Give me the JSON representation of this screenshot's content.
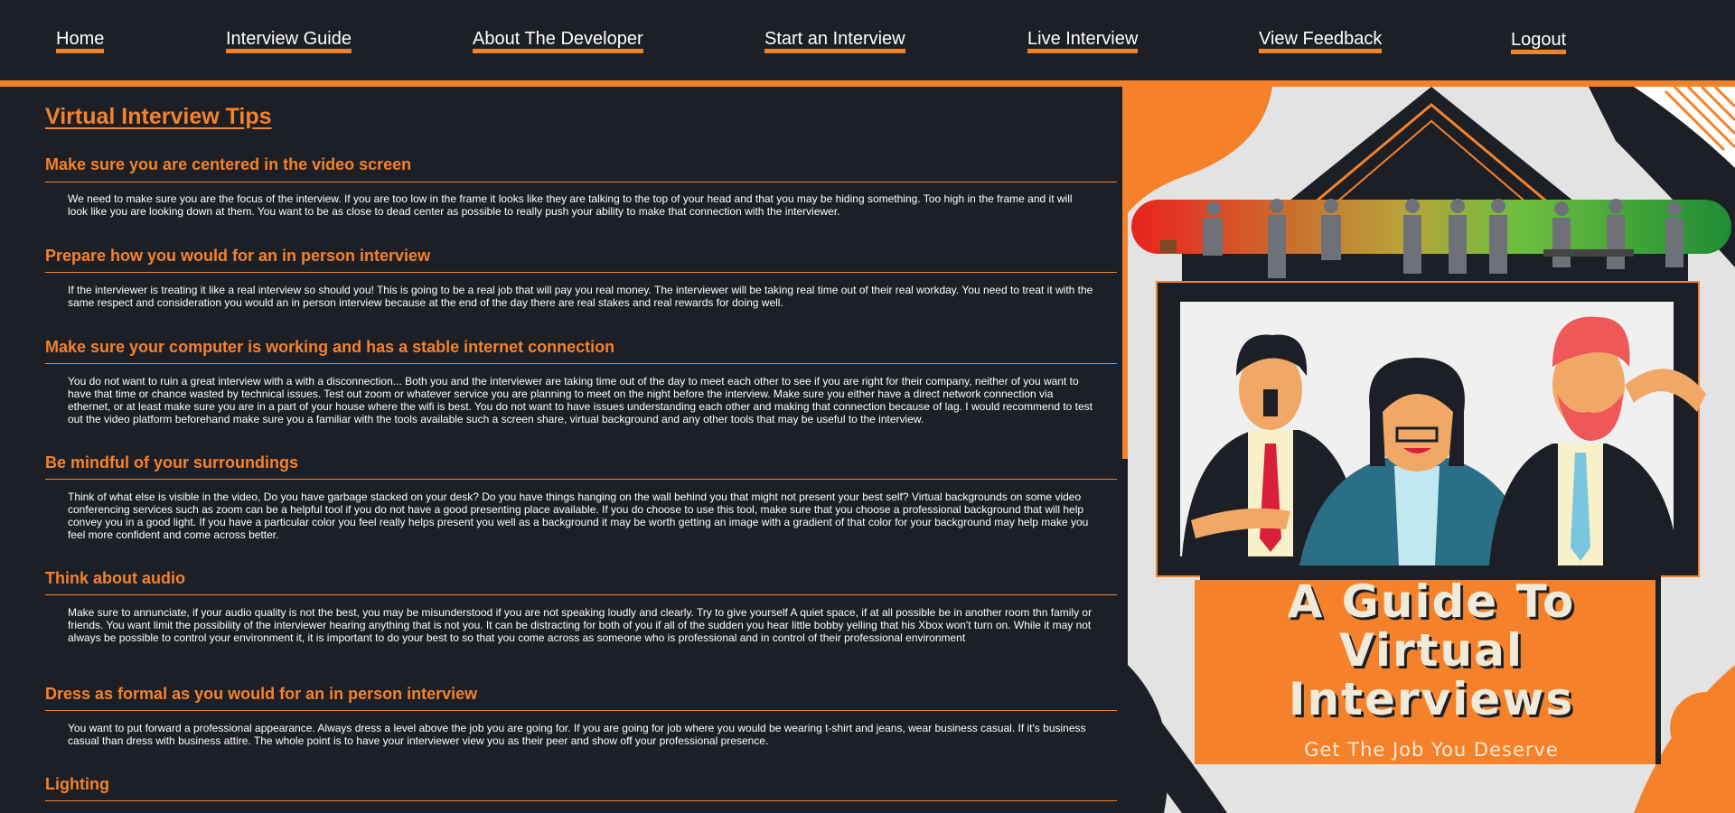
{
  "nav": {
    "items": [
      {
        "label": "Home"
      },
      {
        "label": "Interview Guide"
      },
      {
        "label": "About The Developer"
      },
      {
        "label": "Start an Interview"
      },
      {
        "label": "Live Interview"
      },
      {
        "label": "View Feedback"
      },
      {
        "label": "Logout"
      }
    ]
  },
  "main": {
    "title": "Virtual Interview Tips",
    "sections": [
      {
        "heading": "Make sure you are centered in the video screen",
        "body": "We need to make sure you are the focus of the interview. If you are too low in the frame it looks like they are talking to the top of your head and that you may be hiding something. Too high in the frame and it will look like you are looking down at them. You want to be as close to dead center as possible to really push your ability to make that connection with the interviewer."
      },
      {
        "heading": "Prepare how you would for an in person interview",
        "body": "If the interviewer is treating it like a real interview so should you! This is going to be a real job that will pay you real money. The interviewer will be taking real time out of their real workday. You need to treat it with the same respect and consideration you would an in person interview because at the end of the day there are real stakes and real rewards for doing well."
      },
      {
        "heading": "Make sure your computer is working and has a stable internet connection",
        "body": "You do not want to ruin a great interview with a with a disconnection... Both you and the interviewer are taking time out of the day to meet each other to see if you are right for their company, neither of you want to have that time or chance wasted by technical issues. Test out zoom or whatever service you are planning to meet on the night before the interview. Make sure you either have a direct network connection via ethernet, or at least make sure you are in a part of your house where the wifi is best. You do not want to have issues understanding each other and making that connection because of lag. I would recommend to test out the video platform beforehand make sure you a familiar with the tools available such a screen share, virtual background and any other tools that may be useful to the interview."
      },
      {
        "heading": "Be mindful of your surroundings",
        "body": "Think of what else is visible in the video, Do you have garbage stacked on your desk? Do you have things hanging on the wall behind you that might not present your best self? Virtual backgrounds on some video conferencing services such as zoom can be a helpful tool if you do not have a good presenting place available. If you do choose to use this tool, make sure that you choose a professional background that will help convey you in a good light. If you have a particular color you feel really helps present you well as a background it may be worth getting an image with a gradient of that color for your background may help make you feel more confident and come across better."
      },
      {
        "heading": "Think about audio",
        "body": "Make sure to annunciate, if your audio quality is not the best, you may be misunderstood if you are not speaking loudly and clearly. Try to give yourself A quiet space, if at all possible be in another room thn family or friends. You want limit the possibility of the interviewer hearing anything that is not you. It can be distracting for both of you if all of the sudden you hear little bobby yelling that his Xbox won't turn on. While it may not always be possible to control your environment it, it is important to do your best to so that you come across as someone who is professional and in control of their professional environment"
      },
      {
        "heading": "Dress as formal as you would for an in person interview",
        "body": "You want to put forward a professional appearance. Always dress a level above the job you are going for. If you are going for job where you would be wearing t-shirt and jeans, wear business casual. If it's business casual than dress with business attire. The whole point is to have your interviewer view you as their peer and show off your professional presence."
      },
      {
        "heading": "Lighting",
        "body": ""
      }
    ]
  },
  "poster": {
    "title_line1": "A Guide To",
    "title_line2": "Virtual",
    "title_line3": "Interviews",
    "subtitle": "Get The Job You Deserve"
  },
  "colors": {
    "background": "#1c1f26",
    "accent": "#f5822a",
    "text": "#ffffff",
    "poster_cream": "#f2ead8"
  }
}
